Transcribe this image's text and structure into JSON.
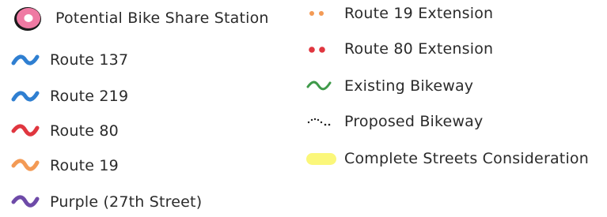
{
  "legend": {
    "station": {
      "label": "Potential Bike Share Station",
      "icon": "pink-donut-icon",
      "color": "#ef7aa3"
    },
    "routes": [
      {
        "key": "r137",
        "label": "Route 137",
        "icon": "blue-wave-icon",
        "color": "#2f7fd1"
      },
      {
        "key": "r219",
        "label": "Route 219",
        "icon": "blue-wave-icon",
        "color": "#2f7fd1"
      },
      {
        "key": "r80",
        "label": "Route 80",
        "icon": "red-wave-icon",
        "color": "#e0363f"
      },
      {
        "key": "r19",
        "label": "Route 19",
        "icon": "orange-wave-icon",
        "color": "#f39a55"
      },
      {
        "key": "purple",
        "label": "Purple (27th Street)",
        "icon": "purple-wave-icon",
        "color": "#6e4aa8"
      }
    ],
    "extensions": [
      {
        "key": "r19ext",
        "label": "Route 19 Extension",
        "icon": "orange-dots-icon",
        "color": "#f39a55"
      },
      {
        "key": "r80ext",
        "label": "Route 80 Extension",
        "icon": "red-dots-icon",
        "color": "#e0363f"
      }
    ],
    "bikeways": [
      {
        "key": "exist",
        "label": "Existing Bikeway",
        "icon": "green-wave-icon",
        "color": "#3f9a4a"
      },
      {
        "key": "prop",
        "label": "Proposed Bikeway",
        "icon": "dotted-line-icon",
        "color": "#222222"
      }
    ],
    "complete_streets": {
      "label": "Complete Streets Consideration",
      "icon": "yellow-highlight-icon",
      "color": "#fbf77a"
    }
  }
}
